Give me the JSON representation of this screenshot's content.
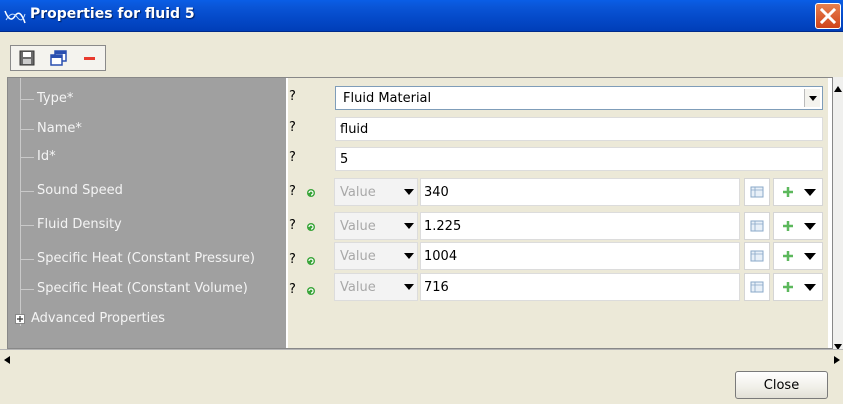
{
  "window": {
    "title": "Properties for fluid 5"
  },
  "toolbar": {
    "buttons": [
      {
        "icon": "save-icon"
      },
      {
        "icon": "copy-window-icon"
      },
      {
        "icon": "remove-icon"
      }
    ]
  },
  "properties": {
    "type": {
      "label": "Type*",
      "help": "?",
      "value": "Fluid Material"
    },
    "name": {
      "label": "Name*",
      "help": "?",
      "value": "fluid"
    },
    "id": {
      "label": "Id*",
      "help": "?",
      "value": "5"
    },
    "sound_speed": {
      "label": "Sound Speed",
      "help": "?",
      "mode": "Value",
      "value": "340"
    },
    "fluid_density": {
      "label": "Fluid Density",
      "help": "?",
      "mode": "Value",
      "value": "1.225"
    },
    "specific_heat_cp": {
      "label": "Specific Heat (Constant Pressure)",
      "help": "?",
      "mode": "Value",
      "value": "1004"
    },
    "specific_heat_cv": {
      "label": "Specific Heat (Constant Volume)",
      "help": "?",
      "mode": "Value",
      "value": "716"
    },
    "advanced": {
      "label": "Advanced Properties"
    }
  },
  "footer": {
    "close_label": "Close"
  },
  "colors": {
    "titlebar": "#0449c8",
    "label_column": "#a0a0a0",
    "close_x": "#d0431a"
  }
}
